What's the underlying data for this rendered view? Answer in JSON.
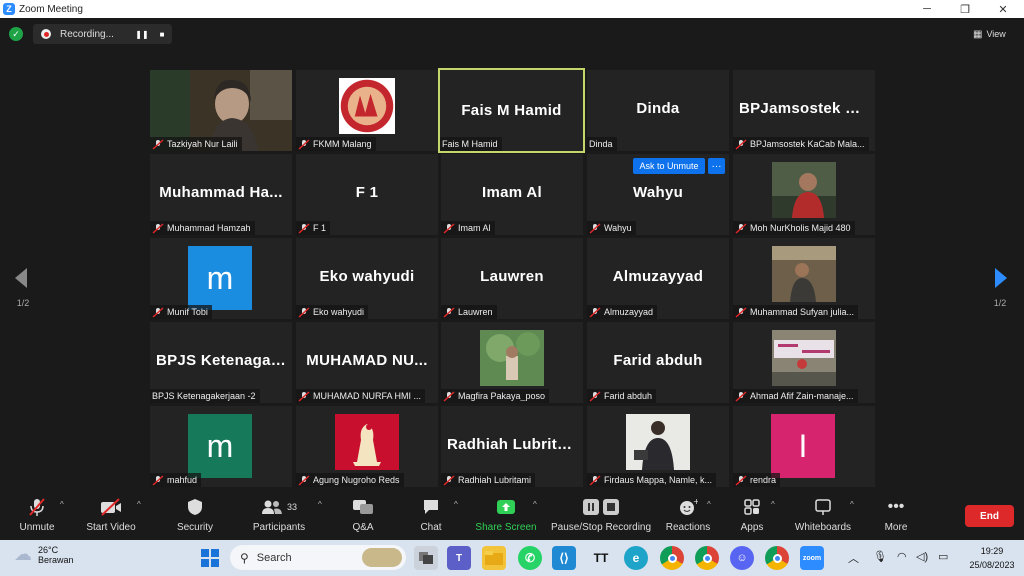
{
  "window": {
    "title": "Zoom Meeting"
  },
  "recording": {
    "label": "Recording..."
  },
  "view": {
    "label": "View"
  },
  "pagination": {
    "left": "1/2",
    "right": "1/2"
  },
  "ask_unmute": "Ask to Unmute",
  "tiles": [
    {
      "big": "",
      "tag": "Tazkiyah Nur Laili"
    },
    {
      "big": "",
      "tag": "FKMM Malang"
    },
    {
      "big": "Fais M Hamid",
      "tag": "Fais M Hamid"
    },
    {
      "big": "Dinda",
      "tag": "Dinda"
    },
    {
      "big": "BPJamsostek Ka...",
      "tag": "BPJamsostek KaCab Mala..."
    },
    {
      "big": "Muhammad Ha...",
      "tag": "Muhammad Hamzah"
    },
    {
      "big": "F 1",
      "tag": "F 1"
    },
    {
      "big": "Imam Al",
      "tag": "Imam Al"
    },
    {
      "big": "Wahyu",
      "tag": "Wahyu"
    },
    {
      "big": "",
      "tag": "Moh NurKholis Majid 480"
    },
    {
      "big": "",
      "avatar_letter": "m",
      "tag": "Munif Tobi"
    },
    {
      "big": "Eko wahyudi",
      "tag": "Eko wahyudi"
    },
    {
      "big": "Lauwren",
      "tag": "Lauwren"
    },
    {
      "big": "Almuzayyad",
      "tag": "Almuzayyad"
    },
    {
      "big": "",
      "tag": "Muhammad Sufyan julia..."
    },
    {
      "big": "BPJS Ketenagak...",
      "tag": "BPJS Ketenagakerjaan -2"
    },
    {
      "big": "MUHAMAD NU...",
      "tag": "MUHAMAD NURFA HMI ..."
    },
    {
      "big": "",
      "tag": "Magfira Pakaya_poso"
    },
    {
      "big": "Farid abduh",
      "tag": "Farid abduh"
    },
    {
      "big": "",
      "tag": "Ahmad Afif Zain-manaje..."
    },
    {
      "big": "",
      "avatar_letter": "m",
      "tag": "mahfud"
    },
    {
      "big": "",
      "tag": "Agung Nugroho Reds"
    },
    {
      "big": "Radhiah Lubrita...",
      "tag": "Radhiah Lubritami"
    },
    {
      "big": "",
      "tag": "Firdaus Mappa, Namle, k..."
    },
    {
      "big": "",
      "avatar_letter": "I",
      "tag": "rendra"
    }
  ],
  "toolbar": {
    "unmute": "Unmute",
    "start_video": "Start Video",
    "security": "Security",
    "participants": "Participants",
    "participants_count": "33",
    "qa": "Q&A",
    "chat": "Chat",
    "share_screen": "Share Screen",
    "pause_stop": "Pause/Stop Recording",
    "reactions": "Reactions",
    "apps": "Apps",
    "whiteboards": "Whiteboards",
    "more": "More",
    "end": "End"
  },
  "taskbar": {
    "temp": "26°C",
    "weather": "Berawan",
    "search": "Search",
    "time": "19:29",
    "date": "25/08/2023"
  },
  "colors": {
    "accent": "#0e72ed",
    "active_speaker": "#c3d76a",
    "end": "#dd2929",
    "share": "#2fd055"
  }
}
